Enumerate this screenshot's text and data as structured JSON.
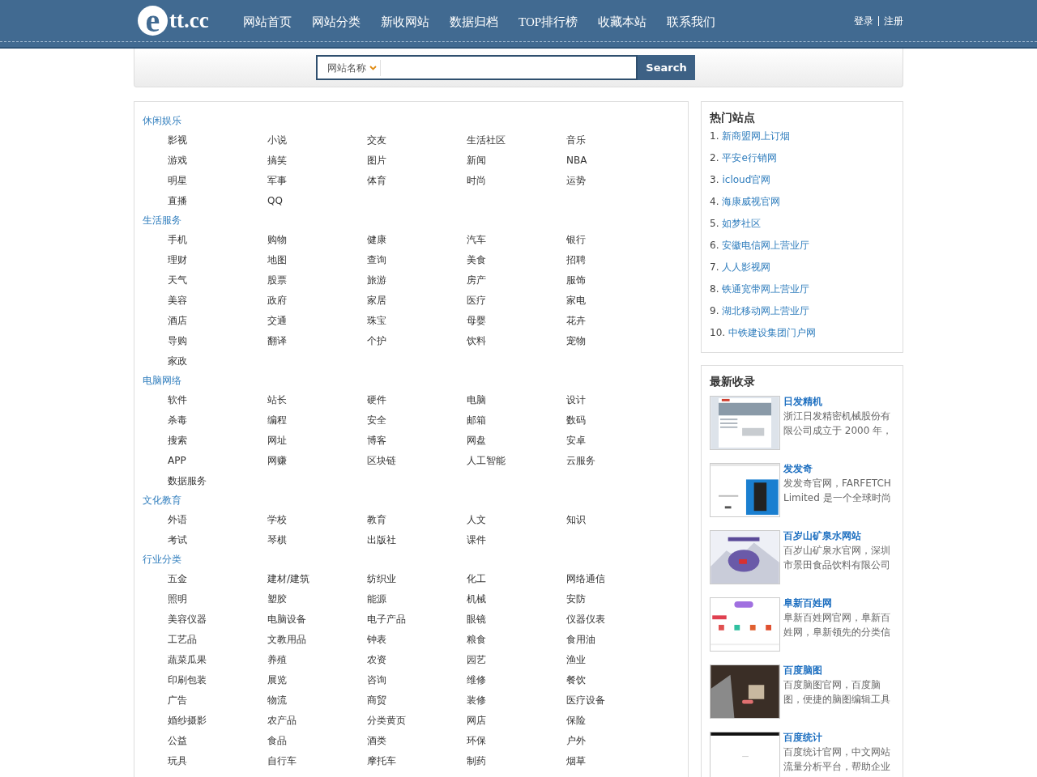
{
  "header": {
    "logo": {
      "mark": "e",
      "text": "tt.cc"
    },
    "nav": [
      "网站首页",
      "网站分类",
      "新收网站",
      "数据归档",
      "TOP排行榜",
      "收藏本站",
      "联系我们"
    ],
    "account_links": [
      "登录",
      "注册"
    ]
  },
  "search": {
    "scope": "网站名称",
    "button": "Search"
  },
  "categories": [
    {
      "title": "休闲娱乐",
      "items": [
        "影视",
        "小说",
        "交友",
        "生活社区",
        "音乐",
        "游戏",
        "搞笑",
        "图片",
        "新闻",
        "NBA",
        "明星",
        "军事",
        "体育",
        "时尚",
        "运势",
        "直播",
        "QQ"
      ]
    },
    {
      "title": "生活服务",
      "items": [
        "手机",
        "购物",
        "健康",
        "汽车",
        "银行",
        "理财",
        "地图",
        "查询",
        "美食",
        "招聘",
        "天气",
        "股票",
        "旅游",
        "房产",
        "服饰",
        "美容",
        "政府",
        "家居",
        "医疗",
        "家电",
        "酒店",
        "交通",
        "珠宝",
        "母婴",
        "花卉",
        "导购",
        "翻译",
        "个护",
        "饮料",
        "宠物",
        "家政"
      ]
    },
    {
      "title": "电脑网络",
      "items": [
        "软件",
        "站长",
        "硬件",
        "电脑",
        "设计",
        "杀毒",
        "编程",
        "安全",
        "邮箱",
        "数码",
        "搜索",
        "网址",
        "博客",
        "网盘",
        "安卓",
        "APP",
        "网赚",
        "区块链",
        "人工智能",
        "云服务",
        "数据服务"
      ]
    },
    {
      "title": "文化教育",
      "items": [
        "外语",
        "学校",
        "教育",
        "人文",
        "知识",
        "考试",
        "琴棋",
        "出版社",
        "课件"
      ]
    },
    {
      "title": "行业分类",
      "items": [
        "五金",
        "建材/建筑",
        "纺织业",
        "化工",
        "网络通信",
        "照明",
        "塑胶",
        "能源",
        "机械",
        "安防",
        "美容仪器",
        "电脑设备",
        "电子产品",
        "眼镜",
        "仪器仪表",
        "工艺品",
        "文教用品",
        "钟表",
        "粮食",
        "食用油",
        "蔬菜瓜果",
        "养殖",
        "农资",
        "园艺",
        "渔业",
        "印刷包装",
        "展览",
        "咨询",
        "维修",
        "餐饮",
        "广告",
        "物流",
        "商贸",
        "装修",
        "医疗设备",
        "婚纱摄影",
        "农产品",
        "分类黄页",
        "网店",
        "保险",
        "公益",
        "食品",
        "酒类",
        "环保",
        "户外",
        "玩具",
        "自行车",
        "摩托车",
        "制药",
        "烟草"
      ]
    }
  ],
  "hot_sites": {
    "title": "热门站点",
    "items": [
      {
        "number": "1.",
        "name": "新商盟网上订烟"
      },
      {
        "number": "2.",
        "name": "平安e行销网"
      },
      {
        "number": "3.",
        "name": "icloud官网"
      },
      {
        "number": "4.",
        "name": "海康威视官网"
      },
      {
        "number": "5.",
        "name": "如梦社区"
      },
      {
        "number": "6.",
        "name": "安徽电信网上营业厅"
      },
      {
        "number": "7.",
        "name": "人人影视网"
      },
      {
        "number": "8.",
        "name": "铁通宽带网上营业厅"
      },
      {
        "number": "9.",
        "name": "湖北移动网上营业厅"
      },
      {
        "number": "10.",
        "name": "中铁建设集团门户网"
      }
    ]
  },
  "latest": {
    "title": "最新收录",
    "items": [
      {
        "title": "日发精机",
        "description": "浙江日发精密机械股份有限公司成立于 2000 年，"
      },
      {
        "title": "发发奇",
        "description": "发发奇官网，FARFETCH Limited 是一个全球时尚"
      },
      {
        "title": "百岁山矿泉水网站",
        "description": "百岁山矿泉水官网，深圳市景田食品饮料有限公司"
      },
      {
        "title": "阜新百姓网",
        "description": "阜新百姓网官网，阜新百姓网，阜新领先的分类信"
      },
      {
        "title": "百度脑图",
        "description": "百度脑图官网，百度脑图，便捷的脑图编辑工具"
      },
      {
        "title": "百度统计",
        "description": "百度统计官网，中文网站流量分析平台，帮助企业"
      }
    ]
  }
}
